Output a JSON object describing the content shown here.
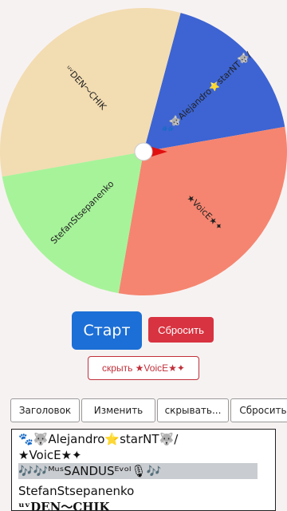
{
  "wheel": {
    "segments": [
      {
        "label": "🐾🐺Alejandro⭐starNT🐺/",
        "color": "#3d64d2"
      },
      {
        "label": "★VoicE★✦",
        "color": "#f58570"
      },
      {
        "label": "StefanStsepanenko",
        "color": "#a7f39a"
      },
      {
        "label": "ᵘᵛDEN〜CHIK",
        "color": "#f2dcb1"
      }
    ],
    "pointer_color": "#e01010",
    "hub_color": "#ffffff"
  },
  "controls": {
    "start_label": "Старт",
    "reset_label": "Сбросить",
    "hide_label": "скрыть ★VoicE★✦"
  },
  "toolbar": {
    "title_label": "Заголовок",
    "edit_label": "Изменить",
    "hide_label": "скрывать...",
    "reset_label": "Сбросить"
  },
  "editor": {
    "lines": [
      "🐾🐺Alejandro⭐starNT🐺/",
      "★VoicE★✦",
      "🎶🎶ᴹᵘˢSANDUSᴱᵛᵒˡ🎙🎶",
      "StefanStsepanenko",
      "ᵘᵛDEN〜CHIK"
    ]
  }
}
